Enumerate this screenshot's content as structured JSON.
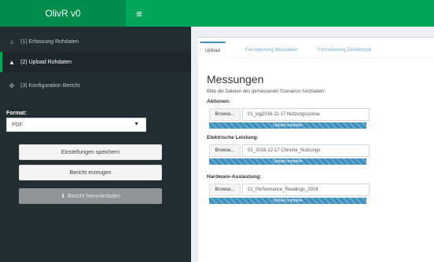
{
  "header": {
    "logo": "OlivR v0",
    "toggle_icon": "≡"
  },
  "sidebar": {
    "items": [
      {
        "label": "(1) Erfassung Rohdaten",
        "icon": "home-icon"
      },
      {
        "label": "(2) Upload Rohdaten",
        "icon": "user-icon"
      },
      {
        "label": "(3) Konfiguration Bericht",
        "icon": "share-alt-icon"
      }
    ],
    "format_label": "Format:",
    "format_value": "PDF",
    "buttons": {
      "save": "Einstellungen speichern",
      "generate": "Bericht erzeugen",
      "download": "Bericht herunterladen"
    }
  },
  "tabs": [
    "Upload",
    "Formatierung Messdaten",
    "Formatierung Zeitstempel"
  ],
  "main": {
    "title": "Messungen",
    "instruction": "Bitte die Dateien des gemessenen Szenarios hochladen:",
    "browse_label": "Browse...",
    "groups": [
      {
        "label": "Aktionen:",
        "file": "01_log2016-11-17 Nutzungsszena",
        "status": "Upload complete",
        "progress": 1.0
      },
      {
        "label": "Elektrische Leistung:",
        "file": "01_2016-12-17 Chrome_Nutzungs",
        "status": "Upload complete",
        "progress": 1.0
      },
      {
        "label": "Hardware-Auslastung:",
        "file": "01_Performance_Readings_2016",
        "status": "Upload complete",
        "progress": 1.0
      }
    ]
  },
  "colors": {
    "header": "#00a65a",
    "logo_bg": "#008d4c",
    "sidebar": "#222d32",
    "progress": "#3c8dbc"
  }
}
